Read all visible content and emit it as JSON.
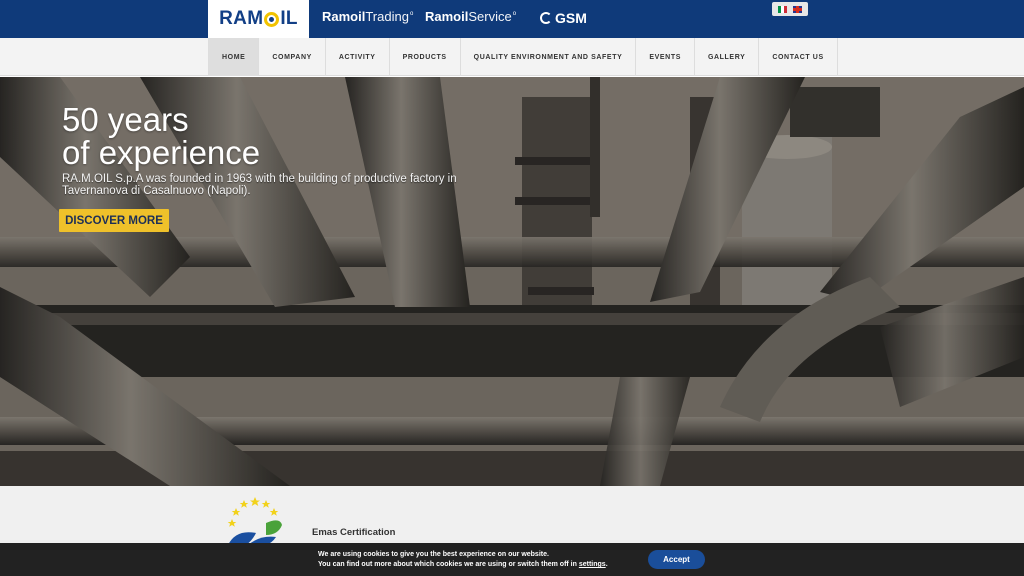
{
  "brands": {
    "main": {
      "part1": "RAM",
      "part2": "IL"
    },
    "trading": {
      "bold": "Ramoil",
      "thin": "Trading",
      "mark": "o"
    },
    "service": {
      "bold": "Ramoil",
      "thin": "Service",
      "mark": "o"
    },
    "gsm": {
      "label": "GSM"
    }
  },
  "languages": {
    "it_icon": "italian-flag-icon",
    "en_icon": "uk-flag-icon"
  },
  "nav": {
    "items": [
      {
        "label": "HOME",
        "active": true
      },
      {
        "label": "COMPANY"
      },
      {
        "label": "ACTIVITY"
      },
      {
        "label": "PRODUCTS"
      },
      {
        "label": "QUALITY ENVIRONMENT AND SAFETY"
      },
      {
        "label": "EVENTS"
      },
      {
        "label": "GALLERY"
      },
      {
        "label": "CONTACT US"
      }
    ]
  },
  "hero": {
    "title_line1": "50 years",
    "title_line2": "of experience",
    "description_line1": "RA.M.OIL S.p.A was founded in 1963 with the building of productive factory in",
    "description_line2": "Tavernanova di Casalnuovo (Napoli).",
    "cta_label": "DISCOVER MORE"
  },
  "emas": {
    "title": "Emas Certification",
    "logo_icon": "emas-eu-stars-logo-icon"
  },
  "cookie": {
    "line1": "We are using cookies to give you the best experience on our website.",
    "line2_prefix": "You can find out more about which cookies we are using or switch them off in ",
    "line2_link": "settings",
    "line2_suffix": ".",
    "accept_label": "Accept"
  },
  "colors": {
    "topbar": "#0f3a7a",
    "nav_bg": "#f3f3f3",
    "cta_bg": "#efc12a",
    "cookie_bg": "#222222",
    "accept_bg": "#1a4e9a"
  }
}
